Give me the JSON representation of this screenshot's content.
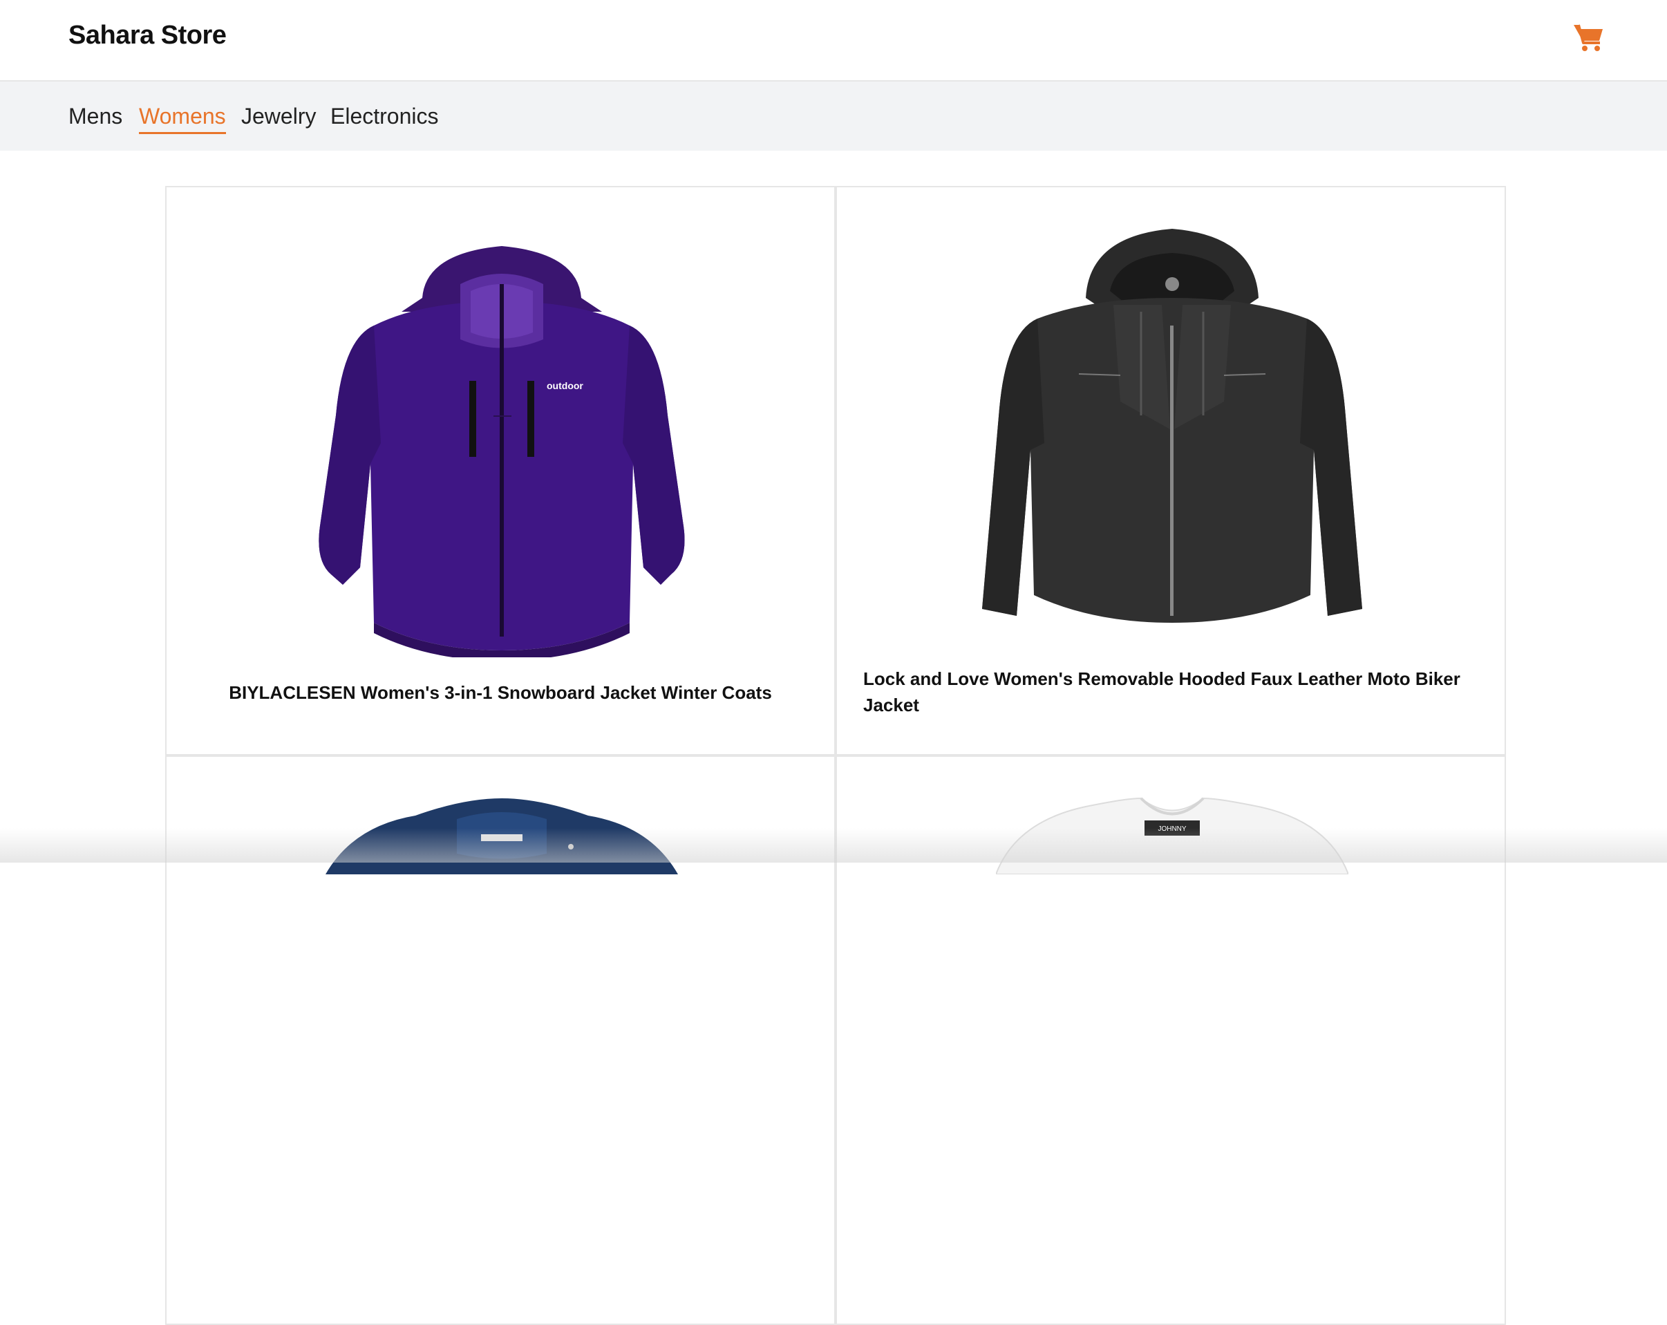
{
  "header": {
    "brand": "Sahara Store",
    "cart_icon": "shopping-cart-icon",
    "accent_color": "#e8742a"
  },
  "nav": {
    "items": [
      {
        "label": "Mens",
        "active": false
      },
      {
        "label": "Womens",
        "active": true
      },
      {
        "label": "Jewelry",
        "active": false
      },
      {
        "label": "Electronics",
        "active": false
      }
    ]
  },
  "products": [
    {
      "title": "BIYLACLESEN Women's 3-in-1 Snowboard Jacket Winter Coats",
      "image": "purple-jacket-image",
      "brand_mark": "outdoor"
    },
    {
      "title": "Lock and Love Women's Removable Hooded Faux Leather Moto Biker Jacket",
      "image": "black-leather-jacket-image"
    },
    {
      "title": "",
      "image": "navy-jacket-image"
    },
    {
      "title": "",
      "image": "white-top-image",
      "brand_mark": "JOHNNY"
    }
  ]
}
